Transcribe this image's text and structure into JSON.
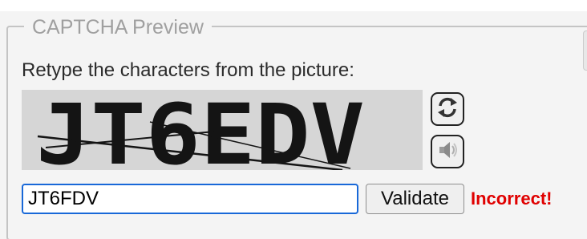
{
  "captcha": {
    "legend": "CAPTCHA Preview",
    "instruction": "Retype the characters from the picture:",
    "image_text": "JT6EDV",
    "refresh_icon": "refresh-icon",
    "audio_icon": "speaker-icon",
    "input_value": "JT6FDV",
    "validate_label": "Validate",
    "status_text": "Incorrect!",
    "status_color": "#e00000",
    "input_focus_color": "#1868d8"
  }
}
